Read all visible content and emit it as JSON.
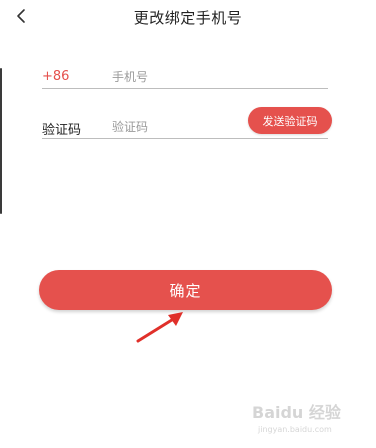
{
  "header": {
    "back_icon": "chevron-left-icon",
    "title": "更改绑定手机号"
  },
  "form": {
    "phone": {
      "prefix": "+86",
      "placeholder": "手机号",
      "value": ""
    },
    "code": {
      "label": "验证码",
      "placeholder": "验证码",
      "value": "",
      "send_label": "发送验证码"
    },
    "confirm_label": "确定"
  },
  "annotation": {
    "arrow_icon": "red-arrow-icon"
  },
  "watermark": {
    "text": "Baidu 经验",
    "subtext": "jingyan.baidu.com"
  },
  "colors": {
    "accent": "#e5514d",
    "text": "#222222",
    "placeholder": "#9a9a9a",
    "divider": "#bdbdbd"
  }
}
